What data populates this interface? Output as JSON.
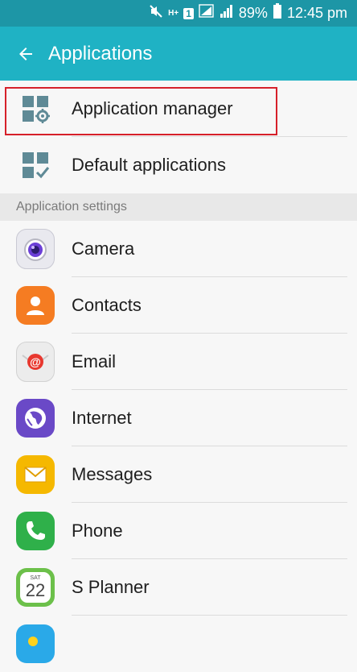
{
  "status_bar": {
    "battery": "89%",
    "time": "12:45 pm",
    "network_label": "H+",
    "sim_label": "1"
  },
  "app_bar": {
    "title": "Applications"
  },
  "top_items": [
    {
      "label": "Application manager",
      "icon": "app-manager-gear-icon"
    },
    {
      "label": "Default applications",
      "icon": "default-apps-check-icon"
    }
  ],
  "section": {
    "title": "Application settings"
  },
  "apps": [
    {
      "label": "Camera",
      "icon": "camera-icon",
      "color": "#e9e9ef"
    },
    {
      "label": "Contacts",
      "icon": "contacts-icon",
      "color": "#f57c22"
    },
    {
      "label": "Email",
      "icon": "email-icon",
      "color": "#ececec"
    },
    {
      "label": "Internet",
      "icon": "internet-icon",
      "color": "#6a49c7"
    },
    {
      "label": "Messages",
      "icon": "messages-icon",
      "color": "#f5b800"
    },
    {
      "label": "Phone",
      "icon": "phone-icon",
      "color": "#2fb04a"
    },
    {
      "label": "S Planner",
      "icon": "calendar-icon",
      "color": "#6cc04a",
      "day_name": "SAT",
      "day_number": "22"
    }
  ],
  "colors": {
    "status_bar": "#1d96a6",
    "app_bar": "#1fb2c4",
    "highlight": "#d6202a",
    "background": "#f7f7f7"
  }
}
